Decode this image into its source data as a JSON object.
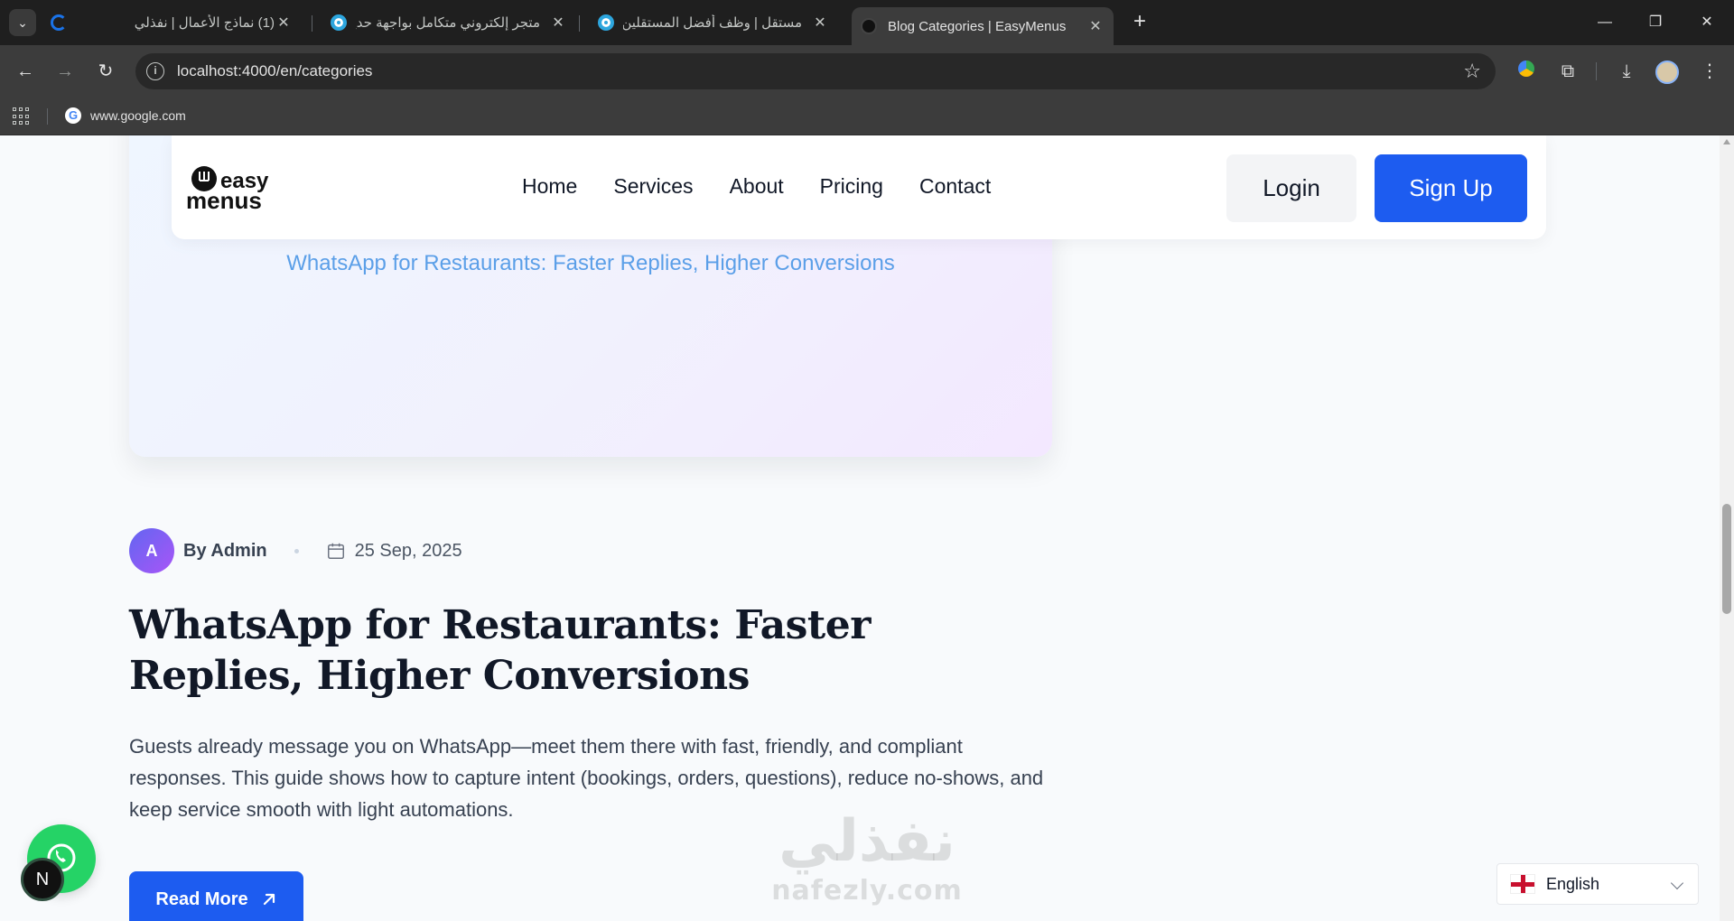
{
  "browser": {
    "tabs": [
      {
        "title": "(1) نماذج الأعمال | نفذلي",
        "active": false
      },
      {
        "title": "متجر إلكتروني متكامل بواجهة حديثة",
        "active": false
      },
      {
        "title": "مستقل | وظف أفضل المستقلين",
        "active": false
      },
      {
        "title": "Blog Categories | EasyMenus",
        "active": true
      }
    ],
    "url": "localhost:4000/en/categories",
    "bookmark": "www.google.com",
    "icons": {
      "tab_list": "chevron-down-icon",
      "back": "arrow-left-icon",
      "forward": "arrow-right-icon",
      "reload": "reload-icon",
      "info": "info-icon",
      "star": "star-icon",
      "extensions": "puzzle-icon",
      "download": "download-icon",
      "menu": "kebab-menu-icon"
    }
  },
  "header": {
    "logo_top": "easy",
    "logo_bottom": "menus",
    "nav": [
      "Home",
      "Services",
      "About",
      "Pricing",
      "Contact"
    ],
    "login": "Login",
    "signup": "Sign Up"
  },
  "post": {
    "hero_title": "WhatsApp for Restaurants: Faster Replies, Higher Conversions",
    "author_initial": "A",
    "author": "By Admin",
    "date": "25 Sep, 2025",
    "title": "WhatsApp for Restaurants: Faster Replies, Higher Conversions",
    "excerpt": "Guests already message you on WhatsApp—meet them there with fast, friendly, and compliant responses. This guide shows how to capture intent (bookings, orders, questions), reduce no-shows, and keep service smooth with light automations.",
    "read_more": "Read More"
  },
  "watermark": {
    "arabic": "نفذلي",
    "latin": "nafezly.com"
  },
  "floating": {
    "badge": "N",
    "language": "English"
  },
  "colors": {
    "primary": "#1d5cf0",
    "hero_title": "#5b9fe8",
    "whatsapp": "#25d366"
  }
}
